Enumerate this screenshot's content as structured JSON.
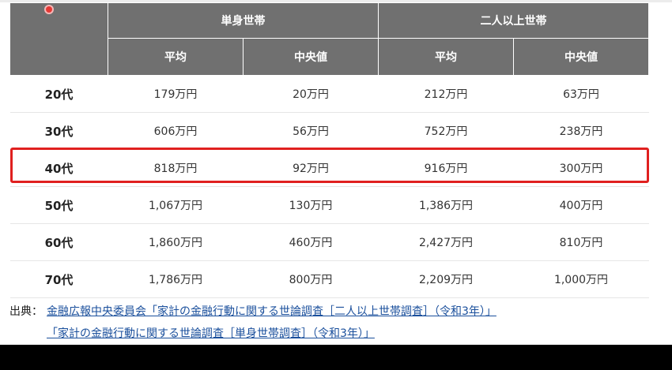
{
  "table": {
    "group_headers": [
      "単身世帯",
      "二人以上世帯"
    ],
    "sub_headers": [
      "平均",
      "中央値",
      "平均",
      "中央値"
    ],
    "rows": [
      {
        "age": "20代",
        "values": [
          "179万円",
          "20万円",
          "212万円",
          "63万円"
        ]
      },
      {
        "age": "30代",
        "values": [
          "606万円",
          "56万円",
          "752万円",
          "238万円"
        ]
      },
      {
        "age": "40代",
        "values": [
          "818万円",
          "92万円",
          "916万円",
          "300万円"
        ]
      },
      {
        "age": "50代",
        "values": [
          "1,067万円",
          "130万円",
          "1,386万円",
          "400万円"
        ]
      },
      {
        "age": "60代",
        "values": [
          "1,860万円",
          "460万円",
          "2,427万円",
          "810万円"
        ]
      },
      {
        "age": "70代",
        "values": [
          "1,786万円",
          "800万円",
          "2,209万円",
          "1,000万円"
        ]
      }
    ],
    "highlighted_row": "40代"
  },
  "source": {
    "label": "出典：",
    "link1": "金融広報中央委員会「家計の金融行動に関する世論調査［二人以上世帯調査］（令和3年）」",
    "link2": "「家計の金融行動に関する世論調査［単身世帯調査］（令和3年）」"
  },
  "colors": {
    "header_bg": "#707070",
    "highlight": "#e0201f",
    "link": "#1a4f9c"
  }
}
